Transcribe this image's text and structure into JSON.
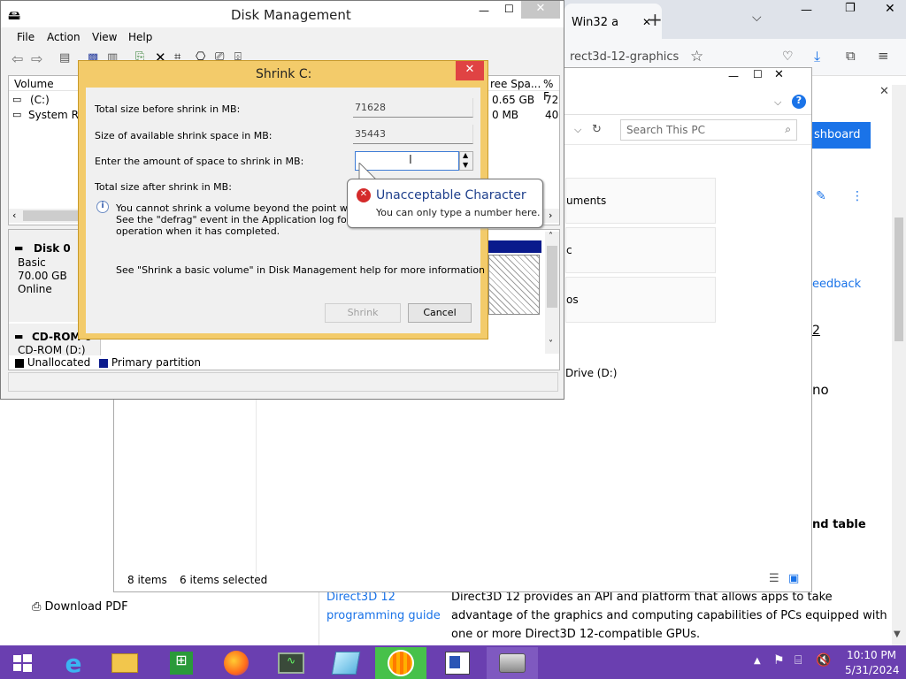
{
  "browser": {
    "tab_label": "Win32 a",
    "tab_close": "✕",
    "new_tab": "+",
    "tab_list": "⌵",
    "window_controls": [
      "—",
      "❐",
      "✕"
    ],
    "address": "rect3d-12-graphics",
    "page": {
      "dashboard_button": "shboard",
      "feedback": "eedback",
      "digit": "2",
      "no": "no",
      "nd_table": "nd table",
      "download_pdf": "Download PDF",
      "table_link_line1": "Direct3D 12",
      "table_link_line2": "programming guide",
      "table_desc_lines": [
        "Direct3D 12 provides an API and platform that allows apps to take",
        "advantage of the graphics and computing capabilities of PCs equipped with",
        "one or more Direct3D 12-compatible GPUs."
      ],
      "close_x": "✕"
    }
  },
  "explorer": {
    "search_placeholder": "Search This PC",
    "items": [
      "uments",
      "c",
      "os"
    ],
    "drive": "Drive (D:)",
    "status_items": "8 items",
    "status_selected": "6 items selected"
  },
  "disk_mgmt": {
    "title": "Disk Management",
    "menu": [
      "File",
      "Action",
      "View",
      "Help"
    ],
    "columns": [
      "Volume",
      "ree Spa...",
      "% F"
    ],
    "rows": [
      {
        "volume": "(C:)",
        "free": "0.65 GB",
        "pct": "72"
      },
      {
        "volume": "System Res",
        "free": "0 MB",
        "pct": "40"
      }
    ],
    "disk0": {
      "name": "Disk 0",
      "type": "Basic",
      "size": "70.00 GB",
      "status": "Online"
    },
    "cdrom": {
      "name": "CD-ROM 0",
      "line2": "CD-ROM (D:)"
    },
    "legend": [
      "Unallocated",
      "Primary partition"
    ]
  },
  "dialog": {
    "title": "Shrink C:",
    "close": "✕",
    "label_total": "Total size before shrink in MB:",
    "value_total": "71628",
    "label_avail": "Size of available shrink space in MB:",
    "value_avail": "35443",
    "label_enter": "Enter the amount of space to shrink in MB:",
    "label_after": "Total size after shrink in MB:",
    "info_lines": [
      "You cannot shrink a volume beyond the point where an",
      "See the \"defrag\" event in the Application log for detaile",
      "operation when it has completed."
    ],
    "help_text": "See \"Shrink a basic volume\" in Disk Management help for more information",
    "shrink_button": "Shrink",
    "cancel_button": "Cancel"
  },
  "tooltip": {
    "title": "Unacceptable Character",
    "message": "You can only type a number here."
  },
  "taskbar": {
    "time": "10:10 PM",
    "date": "5/31/2024"
  },
  "colors": {
    "accent_blue": "#1a73e8",
    "taskbar": "#6a3fb0",
    "dialog_frame": "#f3cb6a",
    "close_red": "#e04343",
    "primary_partition": "#0a1a8c"
  }
}
